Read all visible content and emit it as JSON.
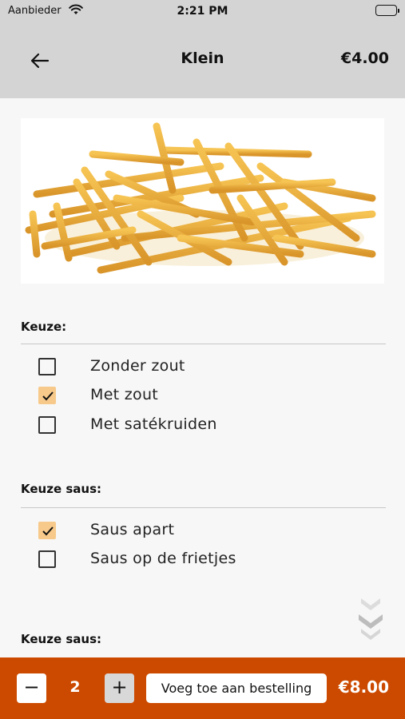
{
  "status_bar": {
    "carrier": "Aanbieder",
    "time": "2:21 PM"
  },
  "header": {
    "title": "Klein",
    "price": "€4.00",
    "back_icon": "arrow-left-icon"
  },
  "product": {
    "image_icon": "fries-image"
  },
  "sections": [
    {
      "title": "Keuze:",
      "options": [
        {
          "label": "Zonder zout",
          "checked": false
        },
        {
          "label": "Met zout",
          "checked": true
        },
        {
          "label": "Met satékruiden",
          "checked": false
        }
      ]
    },
    {
      "title": "Keuze saus:",
      "options": [
        {
          "label": "Saus apart",
          "checked": true
        },
        {
          "label": "Saus op de frietjes",
          "checked": false
        }
      ]
    },
    {
      "title": "Keuze saus:",
      "options": []
    }
  ],
  "bottom_bar": {
    "minus": "−",
    "quantity": "2",
    "plus": "+",
    "add_label": "Voeg toe aan bestelling",
    "total": "€8.00"
  },
  "colors": {
    "header_bg": "#d4d4d4",
    "accent": "#cc4a00",
    "checkbox_checked": "#f7c98a"
  }
}
